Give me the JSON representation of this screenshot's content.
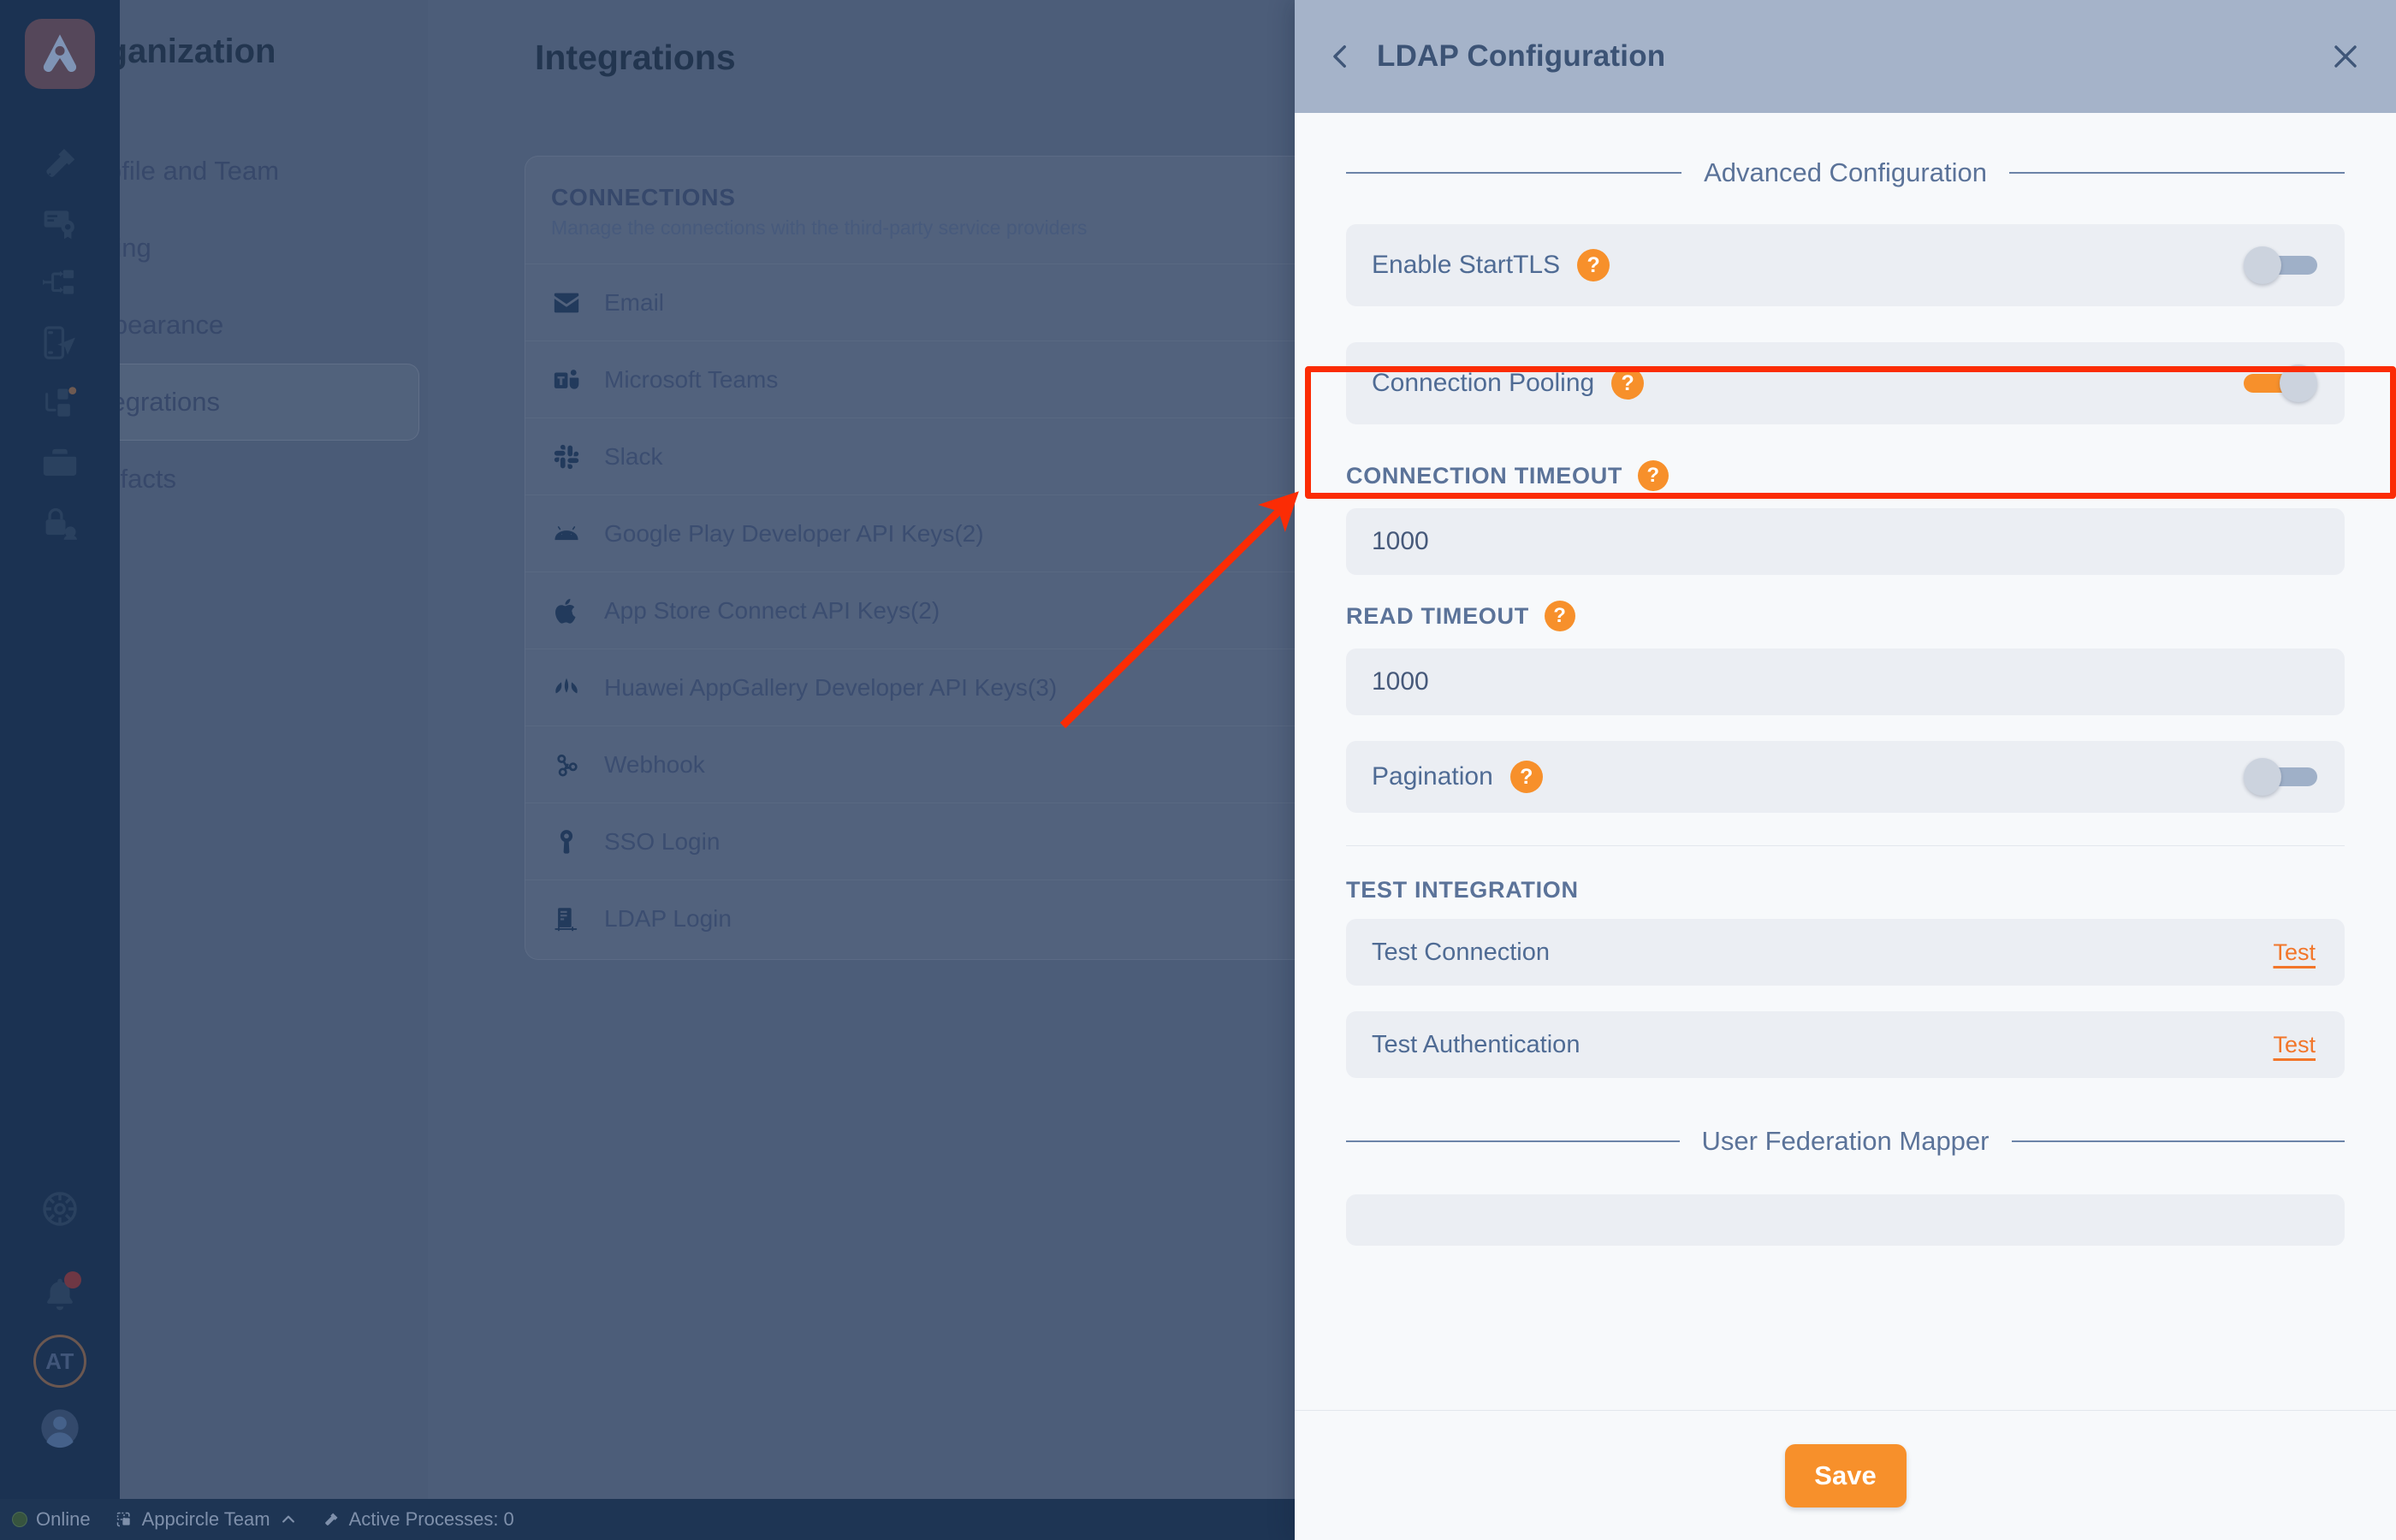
{
  "background": {
    "org_title": "Organization",
    "page_title": "Integrations",
    "menu": [
      {
        "label": "Profile and Team",
        "active": false
      },
      {
        "label": "Billing",
        "active": false
      },
      {
        "label": "Appearance",
        "active": false
      },
      {
        "label": "Integrations",
        "active": true
      },
      {
        "label": "Artifacts",
        "active": false
      }
    ],
    "card": {
      "title": "CONNECTIONS",
      "subtitle": "Manage the connections with the third-party service providers",
      "rows": [
        {
          "label": "Email",
          "icon": "email-icon"
        },
        {
          "label": "Microsoft Teams",
          "icon": "microsoft-teams-icon"
        },
        {
          "label": "Slack",
          "icon": "slack-icon"
        },
        {
          "label": "Google Play Developer API Keys(2)",
          "icon": "android-icon"
        },
        {
          "label": "App Store Connect API Keys(2)",
          "icon": "apple-icon"
        },
        {
          "label": "Huawei AppGallery Developer API Keys(3)",
          "icon": "huawei-icon"
        },
        {
          "label": "Webhook",
          "icon": "webhook-icon"
        },
        {
          "label": "SSO Login",
          "icon": "sso-icon"
        },
        {
          "label": "LDAP Login",
          "icon": "ldap-icon"
        }
      ]
    },
    "status_bar": {
      "online": "Online",
      "team": "Appcircle Team",
      "processes": "Active Processes: 0"
    }
  },
  "panel": {
    "title": "LDAP Configuration",
    "back_icon": "chevron-left-icon",
    "close_icon": "close-icon",
    "sections": {
      "advanced": "Advanced Configuration",
      "user_federation_mapper": "User Federation Mapper"
    },
    "toggles": [
      {
        "label": "Enable StartTLS",
        "state": "off",
        "help": "?"
      },
      {
        "label": "Connection Pooling",
        "state": "on",
        "help": "?"
      },
      {
        "label": "Pagination",
        "state": "off",
        "help": "?"
      }
    ],
    "fields": [
      {
        "label": "CONNECTION TIMEOUT",
        "value": "1000",
        "help": "?"
      },
      {
        "label": "READ TIMEOUT",
        "value": "1000",
        "help": "?"
      }
    ],
    "test_integration": {
      "heading": "TEST INTEGRATION",
      "rows": [
        {
          "label": "Test Connection",
          "action": "Test"
        },
        {
          "label": "Test Authentication",
          "action": "Test"
        }
      ]
    },
    "save_label": "Save"
  },
  "annotation": {
    "highlight_color": "#fb2c05",
    "arrow_color": "#fb2c05"
  },
  "colors": {
    "accent_orange": "#f7902b",
    "link_orange": "#f2762a",
    "panel_header": "#a5b3c9",
    "panel_bg": "#f7f9fb",
    "row_bg": "#ebeef3",
    "rail_navy": "#1b3252",
    "overlay_blue": "#4c5d79"
  }
}
